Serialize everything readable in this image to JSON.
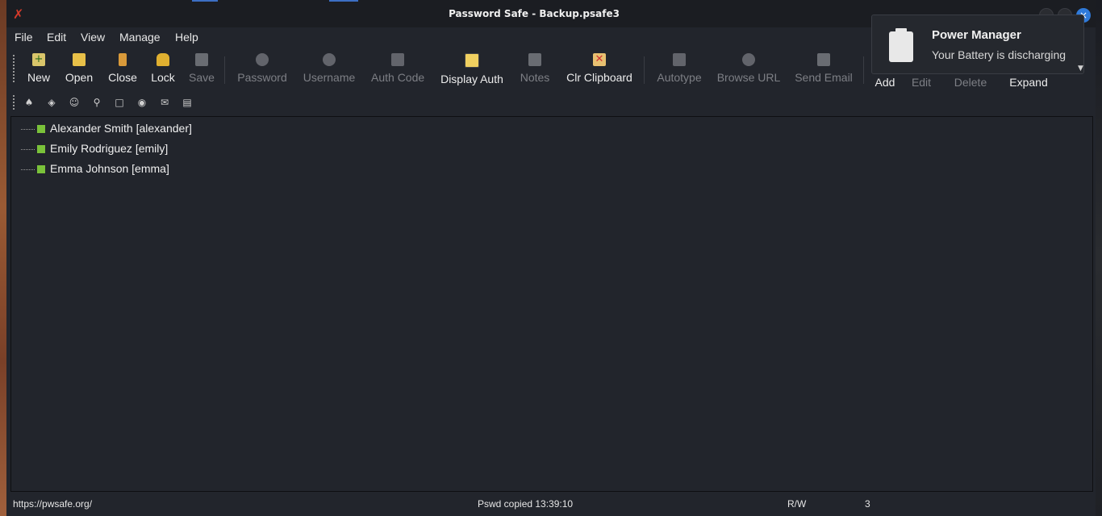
{
  "window": {
    "title": "Password Safe - Backup.psafe3",
    "close_glyph": "×"
  },
  "menu": [
    "File",
    "Edit",
    "View",
    "Manage",
    "Help"
  ],
  "toolbar": {
    "new": "New",
    "open": "Open",
    "close": "Close",
    "lock": "Lock",
    "save": "Save",
    "password": "Password",
    "username": "Username",
    "auth_code": "Auth Code",
    "display_auth": "Display Auth",
    "notes": "Notes",
    "clr_clipboard": "Clr Clipboard",
    "autotype": "Autotype",
    "browse_url": "Browse URL",
    "send_email": "Send Email",
    "add": "Add",
    "edit": "Edit",
    "delete": "Delete",
    "expand": "Expand"
  },
  "entries": [
    "Alexander Smith [alexander]",
    "Emily Rodriguez [emily]",
    "Emma Johnson [emma]"
  ],
  "status": {
    "url": "https://pwsafe.org/",
    "message": "Pswd copied 13:39:10",
    "mode": "R/W",
    "count": "3"
  },
  "notification": {
    "title": "Power Manager",
    "body": "Your Battery is discharging"
  },
  "colors": {
    "window_bg": "#22252c",
    "entry_node": "#7ac23a",
    "close_button": "#2f7ad9",
    "app_icon": "#d43a2a"
  }
}
